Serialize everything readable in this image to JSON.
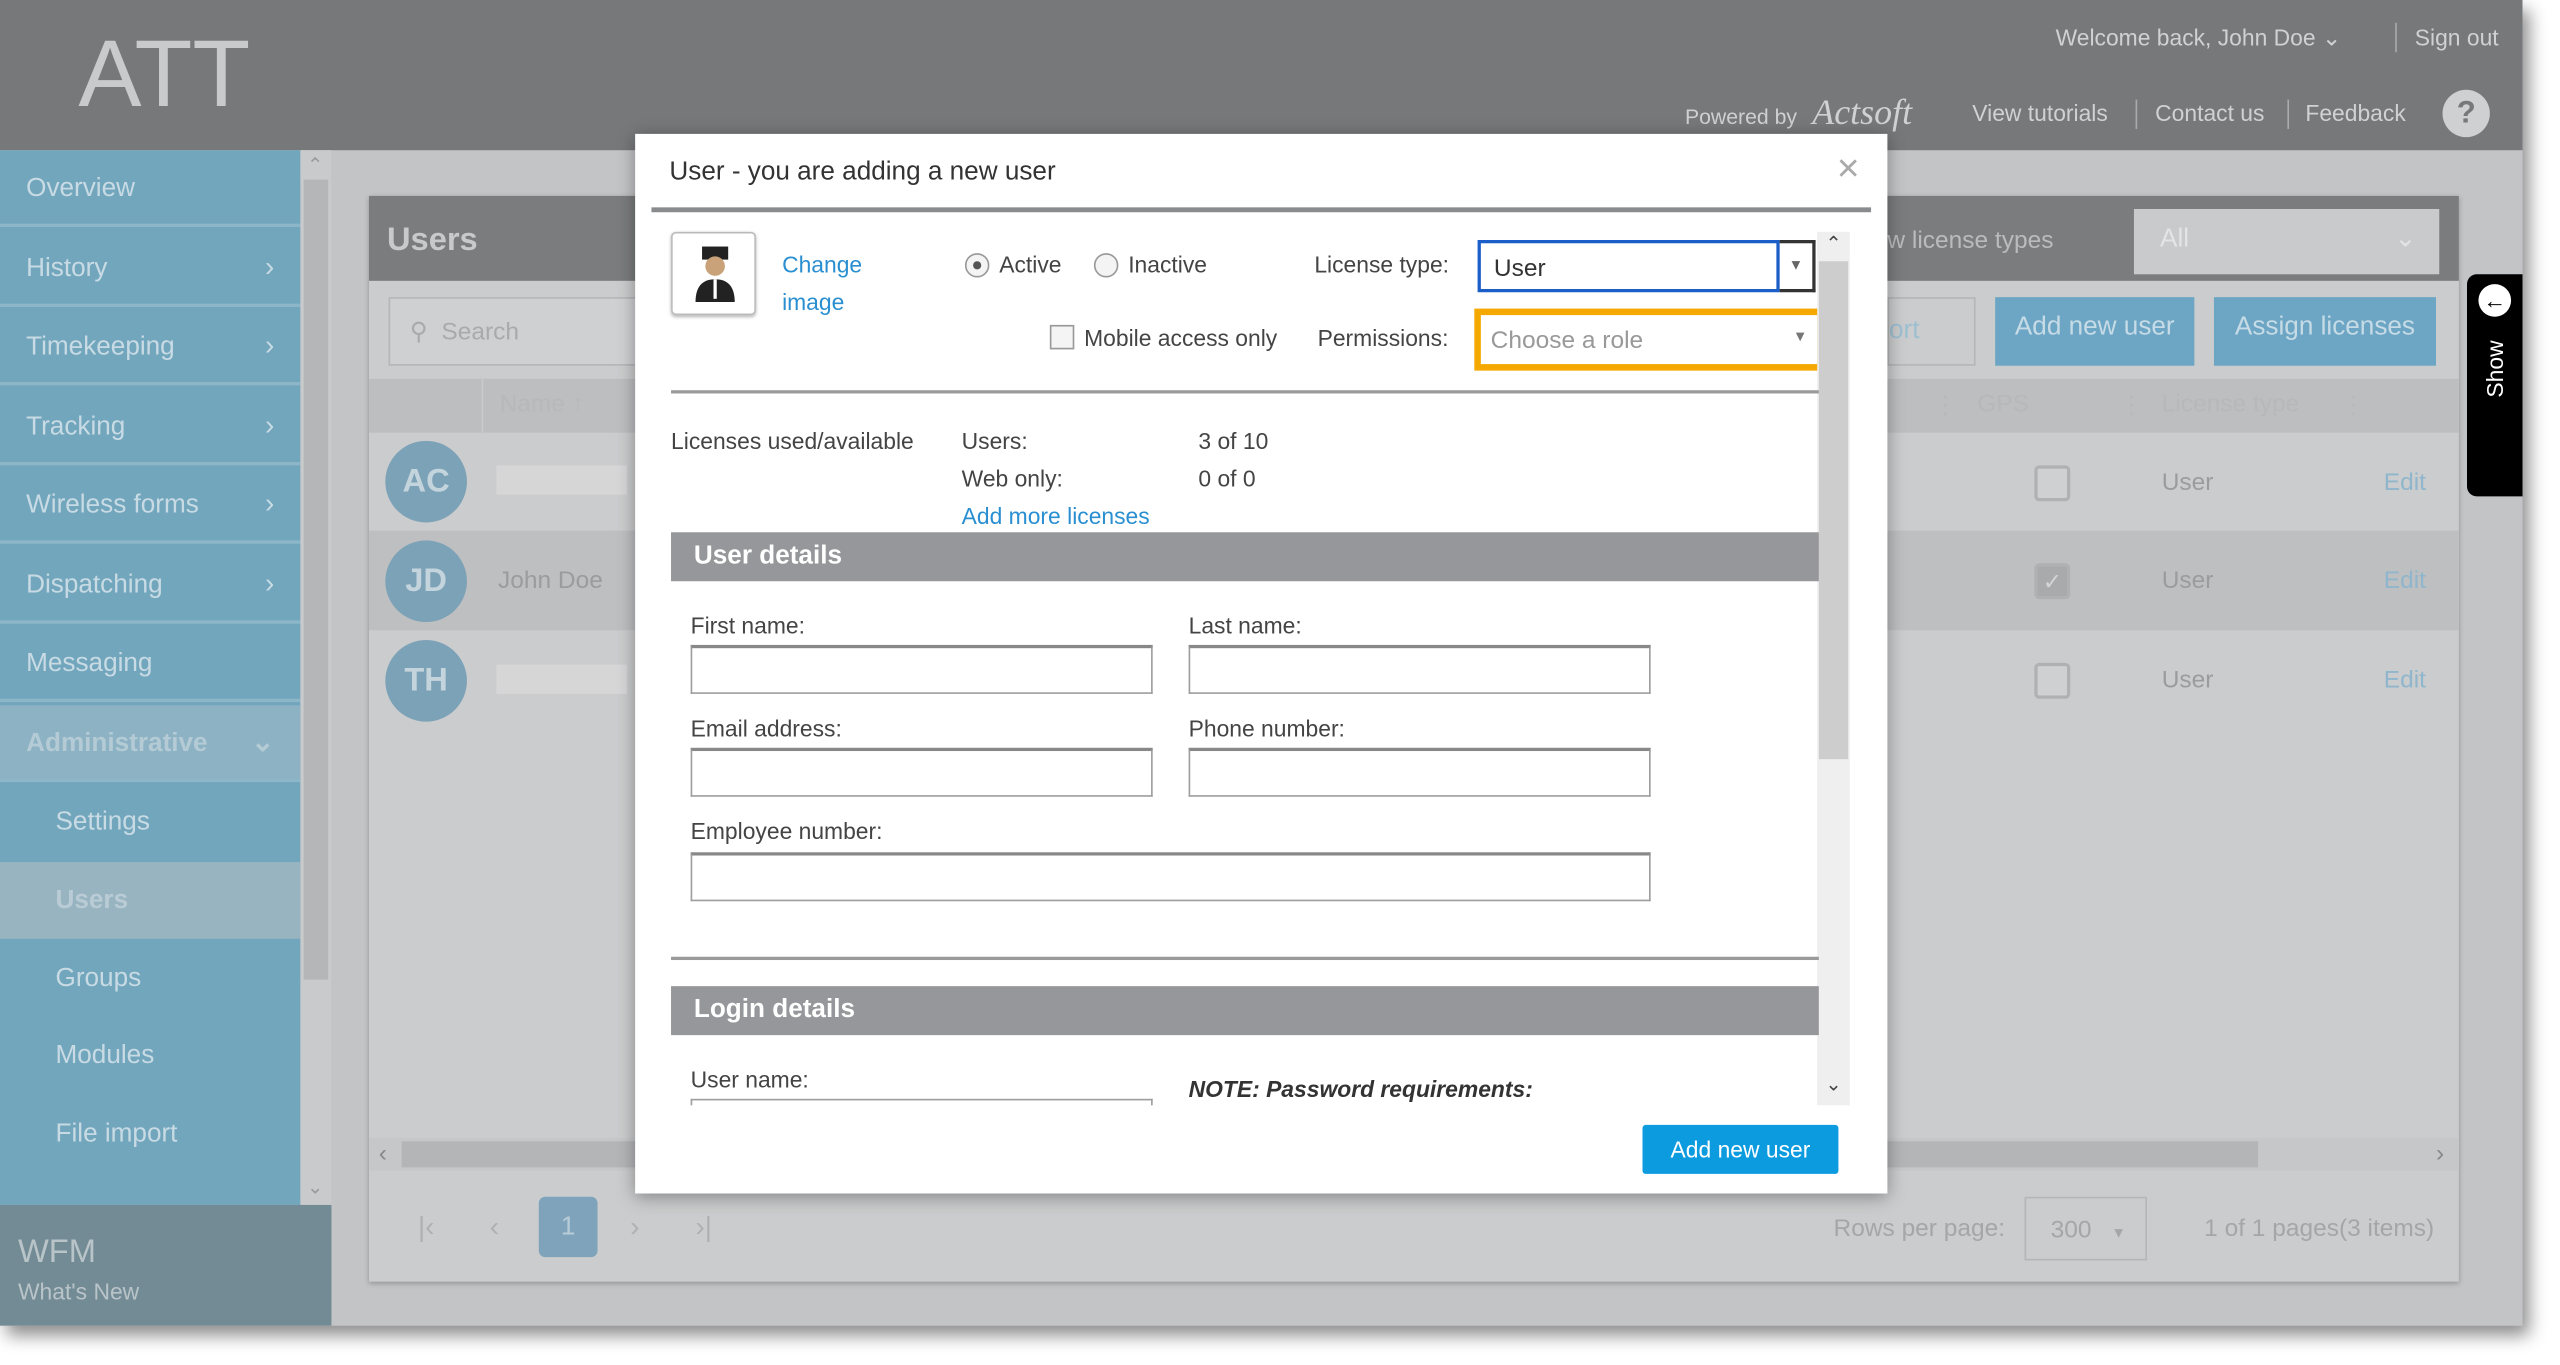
{
  "header": {
    "logo": "ATT",
    "welcome": "Welcome back, John Doe",
    "sign_out": "Sign out",
    "powered_by": "Powered by",
    "brand": "Actsoft",
    "view_tutorials": "View tutorials",
    "contact_us": "Contact us",
    "feedback": "Feedback",
    "help": "?"
  },
  "sidebar": {
    "items": [
      {
        "label": "Overview"
      },
      {
        "label": "History"
      },
      {
        "label": "Timekeeping"
      },
      {
        "label": "Tracking"
      },
      {
        "label": "Wireless forms"
      },
      {
        "label": "Dispatching"
      },
      {
        "label": "Messaging"
      },
      {
        "label": "Administrative"
      }
    ],
    "sub_items": [
      {
        "label": "Settings"
      },
      {
        "label": "Users"
      },
      {
        "label": "Groups"
      },
      {
        "label": "Modules"
      },
      {
        "label": "File import"
      }
    ],
    "footer_title": "WFM",
    "footer_link": "What's New"
  },
  "users_page": {
    "title": "Users",
    "search_placeholder": "Search",
    "license_filter_label": "w license types",
    "license_filter_value": "All",
    "export_partial": "ort",
    "add_new_user": "Add new user",
    "assign_licenses": "Assign licenses",
    "columns": [
      "Name",
      "GPS",
      "License type"
    ],
    "rows": [
      {
        "initials": "AC",
        "name": "",
        "gps": false,
        "license": "User",
        "edit": "Edit"
      },
      {
        "initials": "JD",
        "name": "John Doe",
        "gps": true,
        "license": "User",
        "edit": "Edit"
      },
      {
        "initials": "TH",
        "name": "",
        "gps": false,
        "license": "User",
        "edit": "Edit"
      }
    ],
    "pagination": {
      "current_page": "1",
      "rows_per_page_label": "Rows per page:",
      "rows_per_page": "300",
      "summary": "1 of 1 pages(3 items)"
    },
    "side_tab": "Show"
  },
  "modal": {
    "title": "User - you are adding a new user",
    "change_image": "Change image",
    "status_options": [
      "Active",
      "Inactive"
    ],
    "status_selected": "Active",
    "license_type_label": "License type:",
    "license_type_value": "User",
    "mobile_access_label": "Mobile access only",
    "mobile_access_checked": false,
    "permissions_label": "Permissions:",
    "permissions_placeholder": "Choose a role",
    "highlight_color": "#f5a800",
    "licenses": {
      "label": "Licenses used/available",
      "users_label": "Users:",
      "users_value": "3 of 10",
      "web_label": "Web only:",
      "web_value": "0 of 0",
      "add_more": "Add more licenses"
    },
    "user_details": {
      "title": "User details",
      "first_name": "First name:",
      "last_name": "Last name:",
      "email": "Email address:",
      "phone": "Phone number:",
      "employee": "Employee number:"
    },
    "login_details": {
      "title": "Login details",
      "user_name": "User name:",
      "note": "NOTE: Password requirements:"
    },
    "submit": "Add new user"
  }
}
